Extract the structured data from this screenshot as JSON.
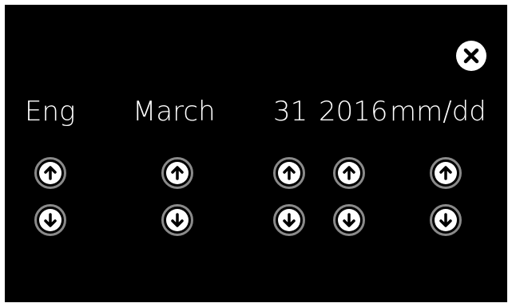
{
  "fields": [
    {
      "id": "language",
      "value": "Eng"
    },
    {
      "id": "month",
      "value": "March"
    },
    {
      "id": "day",
      "value": "31"
    },
    {
      "id": "year",
      "value": "2016"
    },
    {
      "id": "format",
      "value": "mm/dd"
    }
  ],
  "icons": {
    "close": "close-icon",
    "up": "arrow-up-icon",
    "down": "arrow-down-icon"
  },
  "colors": {
    "background": "#000000",
    "text": "#ffffff",
    "button_ring": "#8a8a8a"
  }
}
